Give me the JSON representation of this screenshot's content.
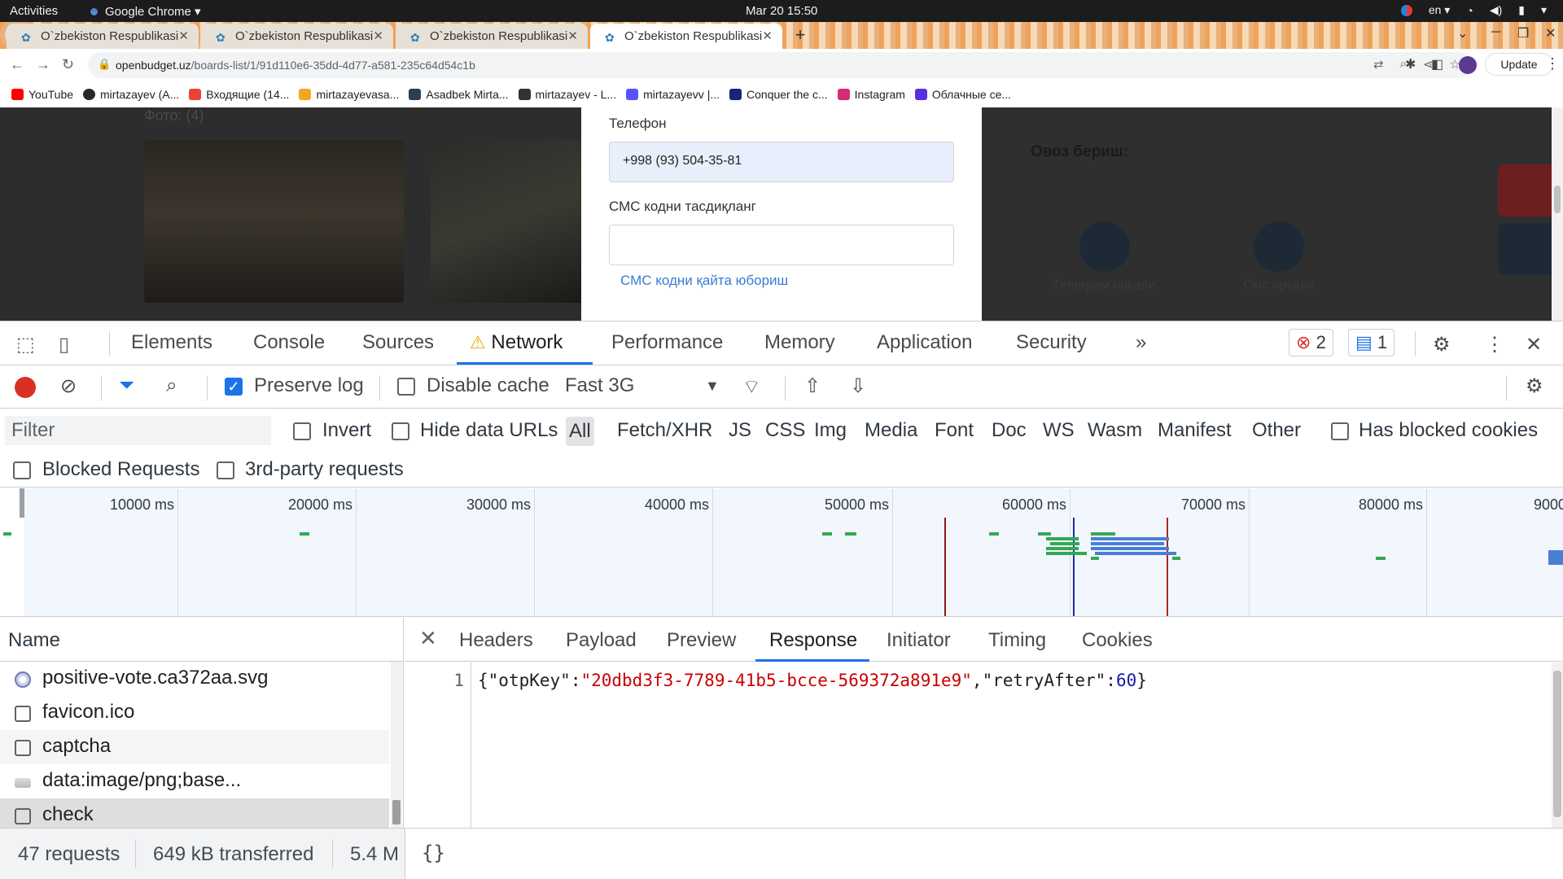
{
  "os_bar": {
    "activities": "Activities",
    "app_name": "Google Chrome ▾",
    "clock": "Mar 20  15:50",
    "lang": "en ▾",
    "tray_icons": [
      "color-picker-icon",
      "wifi-icon",
      "volume-icon",
      "battery-icon",
      "power-menu-icon"
    ]
  },
  "tabs": [
    {
      "label": "O`zbekiston Respublikasi",
      "active": false
    },
    {
      "label": "O`zbekiston Respublikasi",
      "active": false
    },
    {
      "label": "O`zbekiston Respublikasi",
      "active": false
    },
    {
      "label": "O`zbekiston Respublikasi",
      "active": true
    }
  ],
  "toolbar": {
    "url_host": "openbudget.uz",
    "url_path": "/boards-list/1/91d110e6-35dd-4d77-a581-235c64d54c1b",
    "update_label": "Update"
  },
  "bookmarks": [
    {
      "label": "YouTube",
      "icon": "youtube-icon",
      "color": "#ff0000"
    },
    {
      "label": "mirtazayev (A...",
      "icon": "github-icon",
      "color": "#24292e"
    },
    {
      "label": "Входящие (14...",
      "icon": "gmail-icon",
      "color": "#ea4335"
    },
    {
      "label": "mirtazayevasa...",
      "icon": "grid-icon",
      "color": "#f5a623"
    },
    {
      "label": "Asadbek Mirta...",
      "icon": "hackerrank-icon",
      "color": "#2c3e50"
    },
    {
      "label": "mirtazayev - L...",
      "icon": "leetcode-icon",
      "color": "#333333"
    },
    {
      "label": "mirtazayevv |...",
      "icon": "codewars-icon",
      "color": "#5a52ff"
    },
    {
      "label": "Conquer the c...",
      "icon": "codeforces-icon",
      "color": "#1a237e"
    },
    {
      "label": "Instagram",
      "icon": "instagram-icon",
      "color": "#d62976"
    },
    {
      "label": "Облачные се...",
      "icon": "yandex-cloud-icon",
      "color": "#5b2ee0"
    }
  ],
  "page": {
    "foto_label": "Фото: (4)",
    "phone_label": "Телефон",
    "phone_value": "+998 (93) 504-35-81",
    "sms_label": "СМС кодни тасдиқланг",
    "sms_value": "",
    "resend_link": "СМС кодни қайта юбориш",
    "vote_title": "Овоз бериш:",
    "vote_telegram": "Телеграм орқали",
    "vote_sms": "Смс орқали"
  },
  "devtools": {
    "tabs": [
      "Elements",
      "Console",
      "Sources",
      "Network",
      "Performance",
      "Memory",
      "Application",
      "Security"
    ],
    "active_tab": "Network",
    "more": "»",
    "error_count": "2",
    "message_count": "1",
    "preserve_log": "Preserve log",
    "disable_cache": "Disable cache",
    "throttling": "Fast 3G",
    "filter_placeholder": "Filter",
    "invert": "Invert",
    "hide_data_urls": "Hide data URLs",
    "type_filters": [
      "All",
      "Fetch/XHR",
      "JS",
      "CSS",
      "Img",
      "Media",
      "Font",
      "Doc",
      "WS",
      "Wasm",
      "Manifest",
      "Other"
    ],
    "has_blocked_cookies": "Has blocked cookies",
    "blocked_requests": "Blocked Requests",
    "third_party": "3rd-party requests",
    "timeline_ticks": [
      "10000 ms",
      "20000 ms",
      "30000 ms",
      "40000 ms",
      "50000 ms",
      "60000 ms",
      "70000 ms",
      "80000 ms",
      "9000"
    ],
    "name_header": "Name",
    "requests": [
      {
        "name": "positive-vote.ca372aa.svg",
        "icon": "svg"
      },
      {
        "name": "favicon.ico",
        "icon": "doc"
      },
      {
        "name": "captcha",
        "icon": "doc"
      },
      {
        "name": "data:image/png;base...",
        "icon": "img"
      },
      {
        "name": "check",
        "icon": "doc",
        "selected": true
      }
    ],
    "detail_tabs": [
      "Headers",
      "Payload",
      "Preview",
      "Response",
      "Initiator",
      "Timing",
      "Cookies"
    ],
    "active_detail_tab": "Response",
    "response_line_number": "1",
    "response": {
      "p1": "{",
      "k1": "\"otpKey\"",
      "c1": ":",
      "v1": "\"20dbd3f3-7789-41b5-bcce-569372a891e9\"",
      "c2": ",",
      "k2": "\"retryAfter\"",
      "c3": ":",
      "v2": "60",
      "p2": "}"
    },
    "status": {
      "requests": "47 requests",
      "transferred": "649 kB transferred",
      "resources": "5.4 M",
      "pretty_print": "{}"
    }
  }
}
